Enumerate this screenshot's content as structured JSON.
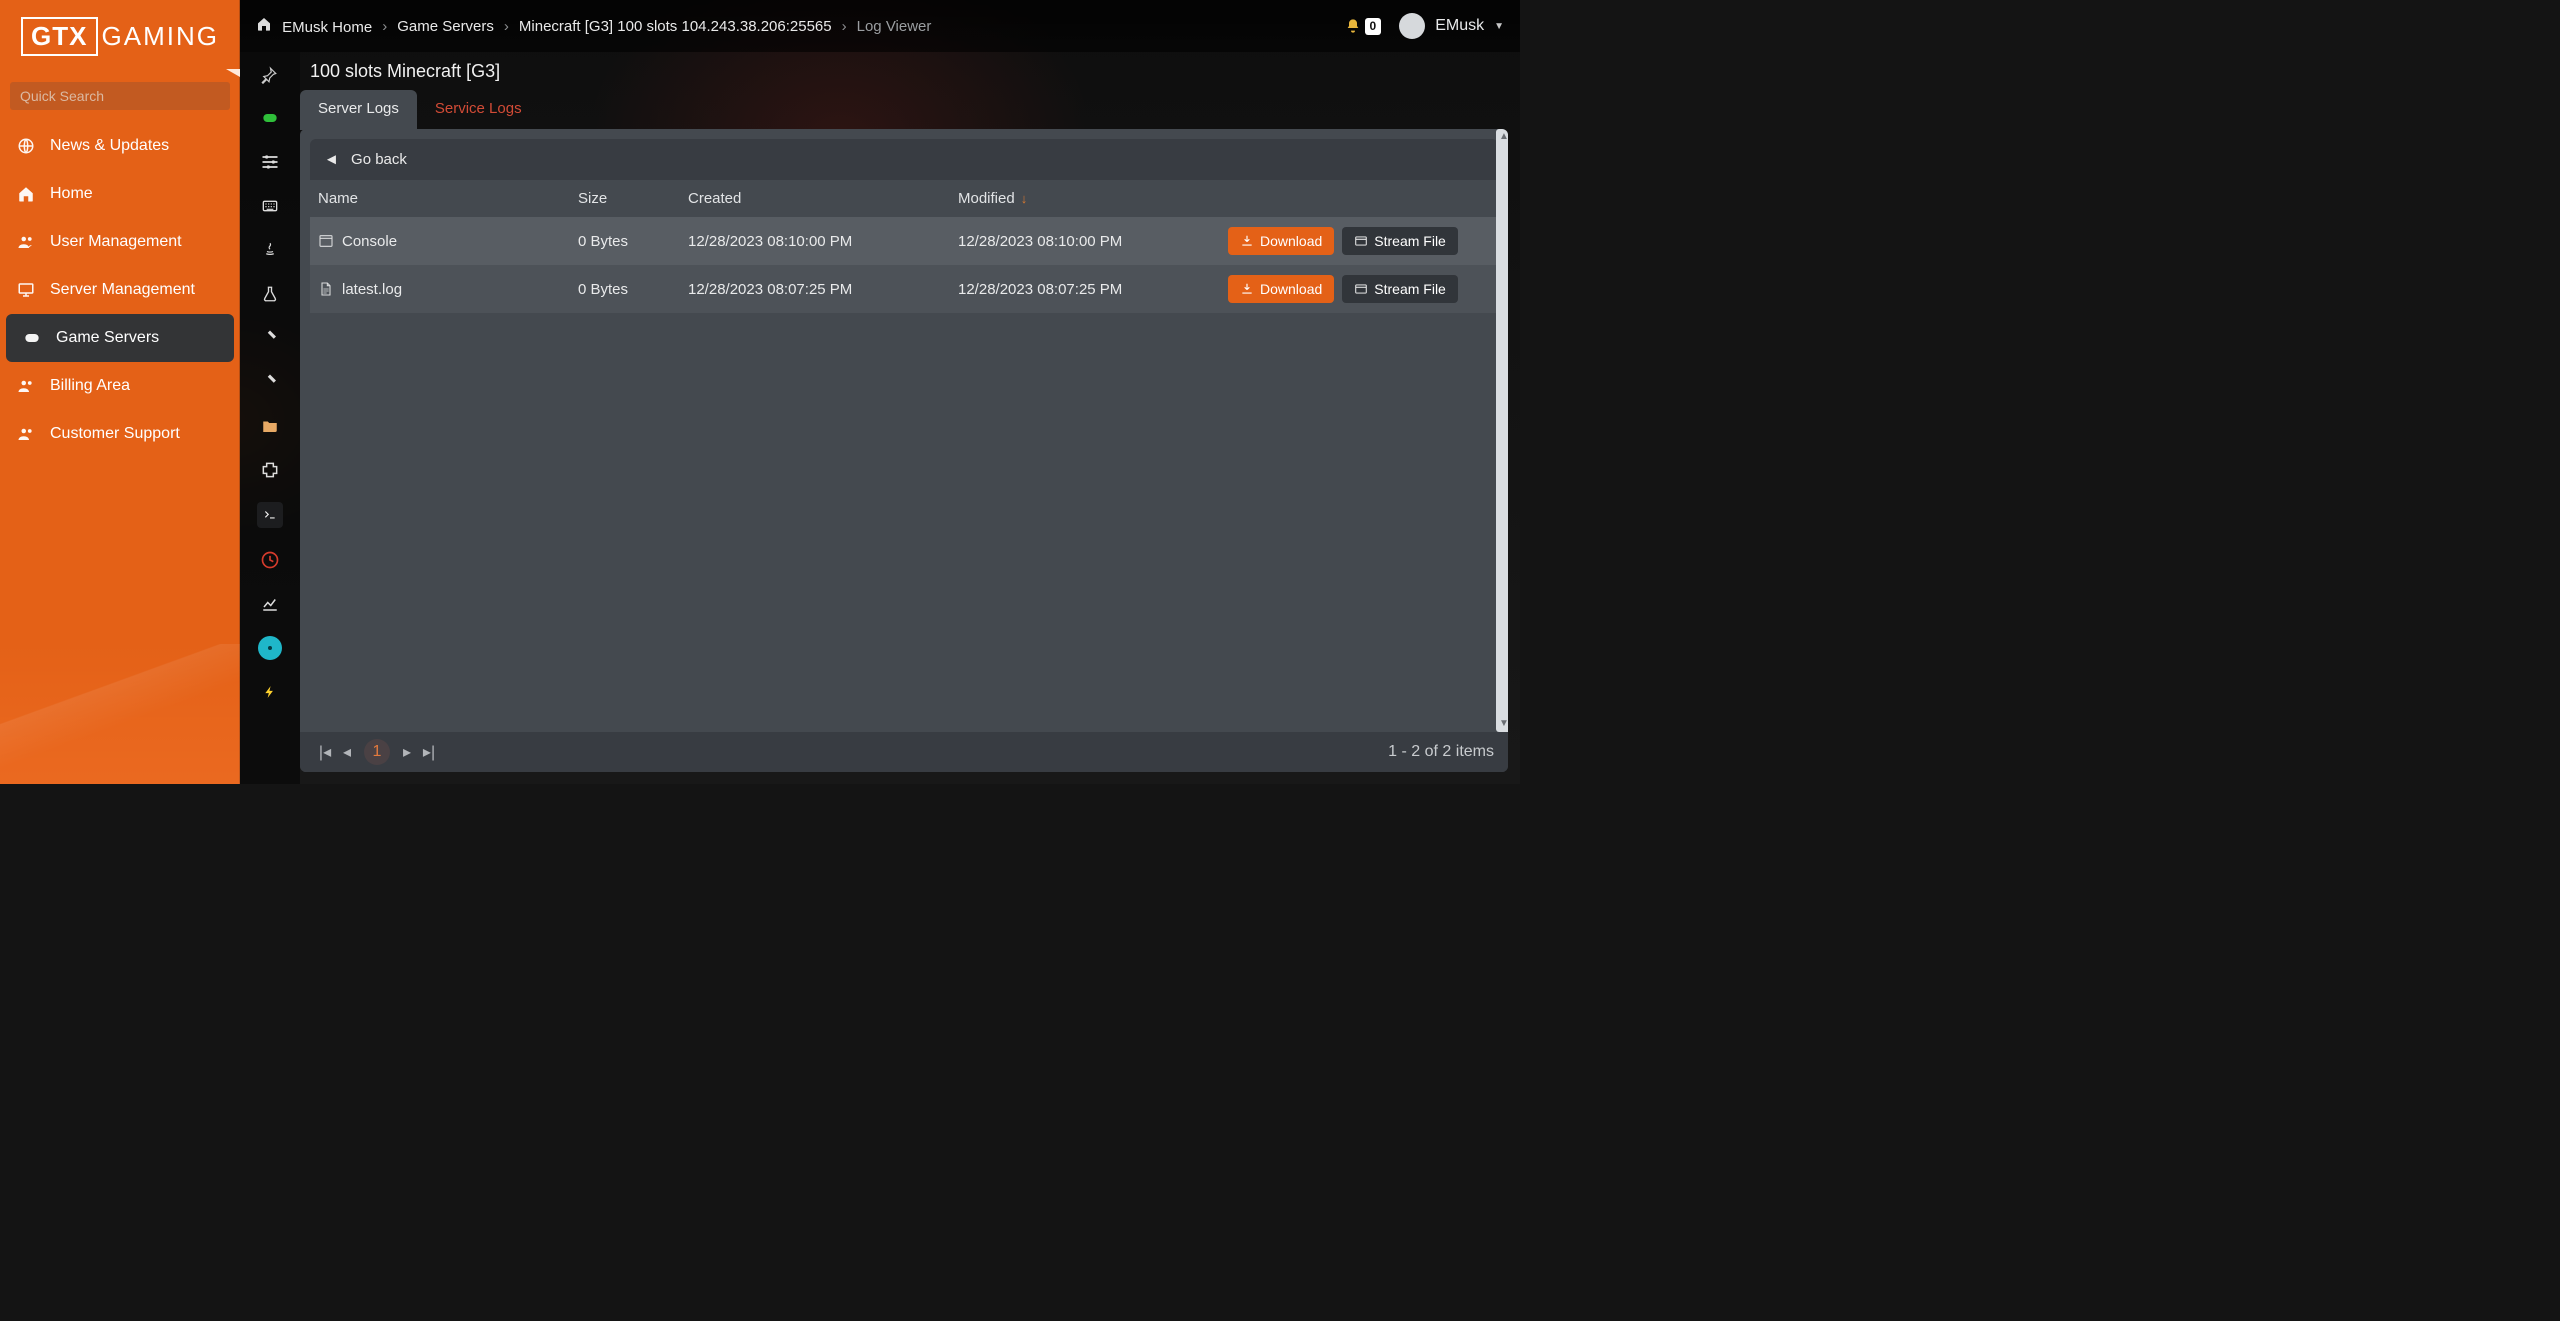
{
  "brand": {
    "logo_left": "GTX",
    "logo_right": "GAMING"
  },
  "search": {
    "placeholder": "Quick Search"
  },
  "sidenav": {
    "items": [
      {
        "icon": "globe",
        "label": "News & Updates"
      },
      {
        "icon": "home",
        "label": "Home"
      },
      {
        "icon": "users",
        "label": "User Management"
      },
      {
        "icon": "monitor",
        "label": "Server Management"
      },
      {
        "icon": "gamepad",
        "label": "Game Servers",
        "active": true
      },
      {
        "icon": "users",
        "label": "Billing Area"
      },
      {
        "icon": "users",
        "label": "Customer Support"
      }
    ]
  },
  "breadcrumb": {
    "home": "EMusk Home",
    "items": [
      "Game Servers",
      "Minecraft [G3] 100 slots 104.243.38.206:25565"
    ],
    "current": "Log Viewer"
  },
  "notifications": {
    "count": "0"
  },
  "user": {
    "name": "EMusk"
  },
  "page_title": "100 slots Minecraft [G3]",
  "tabs": {
    "active": "Server Logs",
    "secondary": "Service Logs"
  },
  "go_back": "Go back",
  "columns": {
    "name": "Name",
    "size": "Size",
    "created": "Created",
    "modified": "Modified"
  },
  "rows": [
    {
      "icon": "window",
      "name": "Console",
      "size": "0 Bytes",
      "created": "12/28/2023 08:10:00 PM",
      "modified": "12/28/2023 08:10:00 PM"
    },
    {
      "icon": "file",
      "name": "latest.log",
      "size": "0 Bytes",
      "created": "12/28/2023 08:07:25 PM",
      "modified": "12/28/2023 08:07:25 PM"
    }
  ],
  "buttons": {
    "download": "Download",
    "stream": "Stream File"
  },
  "pager": {
    "page": "1",
    "summary": "1 - 2 of 2 items"
  }
}
